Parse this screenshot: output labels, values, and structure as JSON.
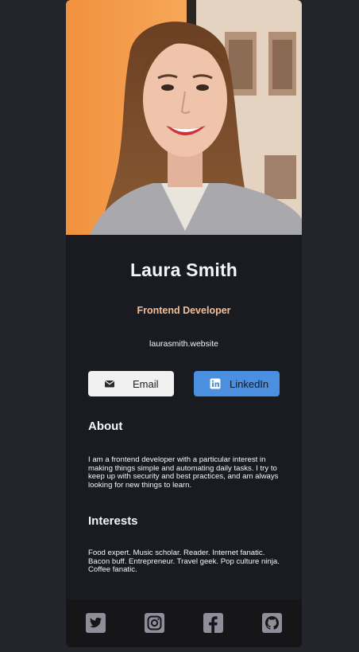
{
  "profile": {
    "name": "Laura Smith",
    "role": "Frontend Developer",
    "website": "laurasmith.website"
  },
  "buttons": {
    "email_label": "Email",
    "linkedin_label": "LinkedIn"
  },
  "about": {
    "title": "About",
    "text": "I am a frontend developer with a particular interest in making things simple and automating daily tasks. I try to keep up with security and best practices, and am always looking for new things to learn."
  },
  "interests": {
    "title": "Interests",
    "text": "Food expert. Music scholar. Reader. Internet fanatic. Bacon buff. Entrepreneur. Travel geek. Pop culture ninja. Coffee fanatic."
  },
  "social_icons": [
    "twitter-icon",
    "instagram-icon",
    "facebook-icon",
    "github-icon"
  ],
  "colors": {
    "background": "#23252c",
    "card": "#1a1b21",
    "footer": "#161619",
    "accent_role": "#f3bf99",
    "linkedin_button": "#4b8fe0",
    "email_button": "#f1f1f1",
    "icon_gray": "#918e9b"
  }
}
